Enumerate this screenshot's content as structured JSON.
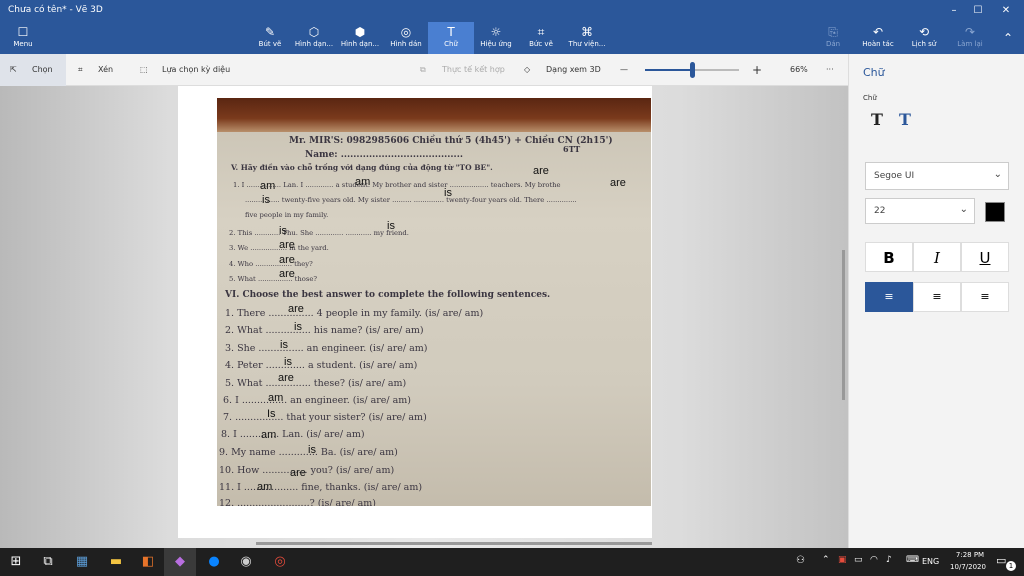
{
  "titlebar": {
    "title": "Chưa có tên* - Vẽ 3D",
    "min": "–",
    "max": "☐",
    "close": "✕"
  },
  "ribbon": {
    "menu": "Menu",
    "tools": [
      {
        "label": "Bút vẽ",
        "icon": "✎"
      },
      {
        "label": "Hình dạn...",
        "icon": "⬡"
      },
      {
        "label": "Hình dạn...",
        "icon": "⬢"
      },
      {
        "label": "Hình dán",
        "icon": "◎"
      },
      {
        "label": "Chữ",
        "icon": "T"
      },
      {
        "label": "Hiệu ứng",
        "icon": "☼"
      },
      {
        "label": "Bức vẽ",
        "icon": "⌗"
      },
      {
        "label": "Thư viện...",
        "icon": "⌘"
      }
    ],
    "right": [
      {
        "label": "Dán",
        "icon": "⎘"
      },
      {
        "label": "Hoàn tác",
        "icon": "↶"
      },
      {
        "label": "Lịch sử",
        "icon": "⟲"
      },
      {
        "label": "Làm lại",
        "icon": "↷"
      }
    ],
    "collapse": "⌃"
  },
  "toolbar": {
    "select": "Chọn",
    "crop": "Xén",
    "magic": "Lựa chọn kỳ diệu",
    "mixed": "Thực tế kết hợp",
    "view3d": "Dạng xem 3D",
    "minus": "—",
    "plus": "+",
    "zoom": "66%",
    "zoom_level": 0.5,
    "more": "···"
  },
  "panel": {
    "header": "Chữ",
    "section": "Chữ",
    "font": "Segoe UI",
    "size": "22",
    "color": "#000000",
    "bold": "B",
    "italic": "I",
    "underline": "U"
  },
  "worksheet": {
    "header1": "Mr. MIR'S: 0982985606    Chiều thứ 5 (4h45') + Chiều CN (2h15')",
    "header2": "Name: .......................................",
    "header3": "6TT",
    "sectionV": "V. Hãy điền vào chỗ trống với dạng đúng của động từ \"TO BE\".",
    "lines": [
      "1. I ................ Lan. I ............. a student. My brother and sister .................. teachers. My brothe",
      "................ twenty-five years old. My sister ......... .............. twenty-four years old. There ..............",
      "five people in my family.",
      "2. This ............ Thu. She ............. ............ my friend.",
      "3. We ................. in the yard.",
      "4. Who ................. they?",
      "5. What ................ those?"
    ],
    "sectionVI": "VI. Choose the best answer to complete the following sentences.",
    "items": [
      "1. There ............... 4 people in my family. (is/ are/ am)",
      "2. What ............... his name? (is/ are/ am)",
      "3. She ............... an engineer. (is/ are/ am)",
      "4. Peter ............. a student. (is/ are/ am)",
      "5. What ............... these? (is/ are/ am)",
      "6. I ............... an engineer. (is/ are/ am)",
      "7. ................ that your sister? (is/ are/ am)",
      "8. I ............. Lan. (is/ are/ am)",
      "9. My name ............. Ba. (is/ are/ am)",
      "10. How ............... you? (is/ are/ am)",
      "11. I .................. fine, thanks. (is/ are/ am)",
      "12. ........................? (is/ are/ am)"
    ],
    "answers": [
      "am",
      "am",
      "are",
      "are",
      "is",
      "is",
      "is",
      "is",
      "are",
      "are",
      "are",
      "are",
      "is",
      "is",
      "is",
      "are",
      "am",
      "Is",
      "am",
      "is",
      "are",
      "am"
    ]
  },
  "taskbar": {
    "lang": "ENG",
    "time": "7:28 PM",
    "date": "10/7/2020",
    "notif": "1"
  }
}
